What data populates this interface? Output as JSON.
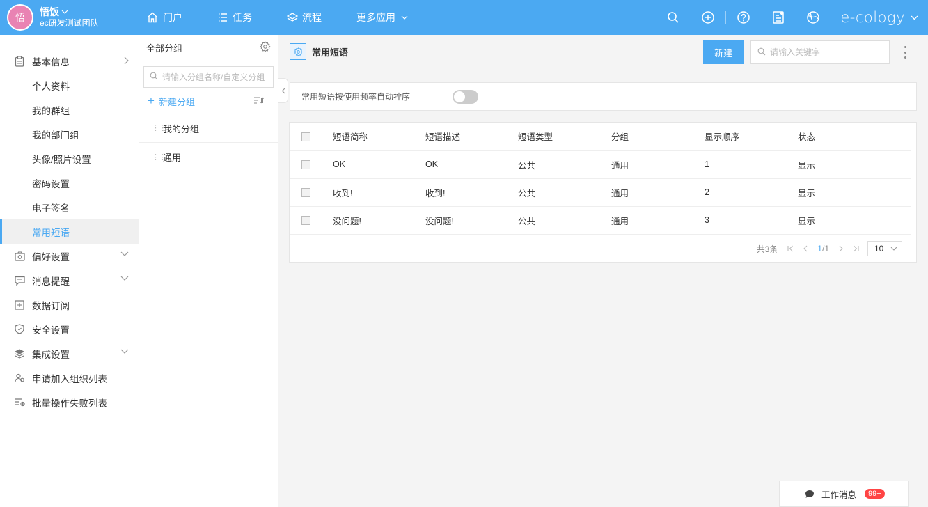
{
  "header": {
    "avatar_text": "悟",
    "user_name": "悟饭",
    "team": "ec研发测试团队",
    "nav": [
      {
        "label": "门户",
        "icon": "home-icon"
      },
      {
        "label": "任务",
        "icon": "list-icon"
      },
      {
        "label": "流程",
        "icon": "layers-icon"
      },
      {
        "label": "更多应用",
        "icon": "chevron-down-icon"
      }
    ],
    "brand": "e-cology",
    "brand_color": "#4ba9f2"
  },
  "sidebar": {
    "items": [
      {
        "label": "基本信息",
        "icon": "clipboard-icon",
        "type": "parent"
      },
      {
        "label": "个人资料",
        "type": "sub"
      },
      {
        "label": "我的群组",
        "type": "sub"
      },
      {
        "label": "我的部门组",
        "type": "sub"
      },
      {
        "label": "头像/照片设置",
        "type": "sub"
      },
      {
        "label": "密码设置",
        "type": "sub"
      },
      {
        "label": "电子签名",
        "type": "sub"
      },
      {
        "label": "常用短语",
        "type": "sub",
        "active": true
      },
      {
        "label": "偏好设置",
        "icon": "camera-icon",
        "type": "parent"
      },
      {
        "label": "消息提醒",
        "icon": "message-icon",
        "type": "parent"
      },
      {
        "label": "数据订阅",
        "icon": "subscribe-icon",
        "type": "parent"
      },
      {
        "label": "安全设置",
        "icon": "shield-icon",
        "type": "parent"
      },
      {
        "label": "集成设置",
        "icon": "stack-icon",
        "type": "parent"
      },
      {
        "label": "申请加入组织列表",
        "icon": "users-icon",
        "type": "parent"
      },
      {
        "label": "批量操作失败列表",
        "icon": "list-error-icon",
        "type": "parent"
      }
    ]
  },
  "groups": {
    "title": "全部分组",
    "search_placeholder": "请输入分组名称/自定义分组",
    "add_label": "新建分组",
    "items": [
      "我的分组",
      "通用"
    ]
  },
  "main": {
    "title": "常用短语",
    "new_button": "新建",
    "search_placeholder": "请输入关键字",
    "setting_label": "常用短语按使用频率自动排序",
    "table": {
      "headers": [
        "短语简称",
        "短语描述",
        "短语类型",
        "分组",
        "显示顺序",
        "状态"
      ],
      "rows": [
        [
          "OK",
          "OK",
          "公共",
          "通用",
          "1",
          "显示"
        ],
        [
          "收到!",
          "收到!",
          "公共",
          "通用",
          "2",
          "显示"
        ],
        [
          "没问题!",
          "没问题!",
          "公共",
          "通用",
          "3",
          "显示"
        ]
      ]
    },
    "pager": {
      "total": "共3条",
      "current": "1",
      "of": "/1",
      "page_size": "10"
    }
  },
  "messages": {
    "label": "工作消息",
    "badge": "99+"
  }
}
